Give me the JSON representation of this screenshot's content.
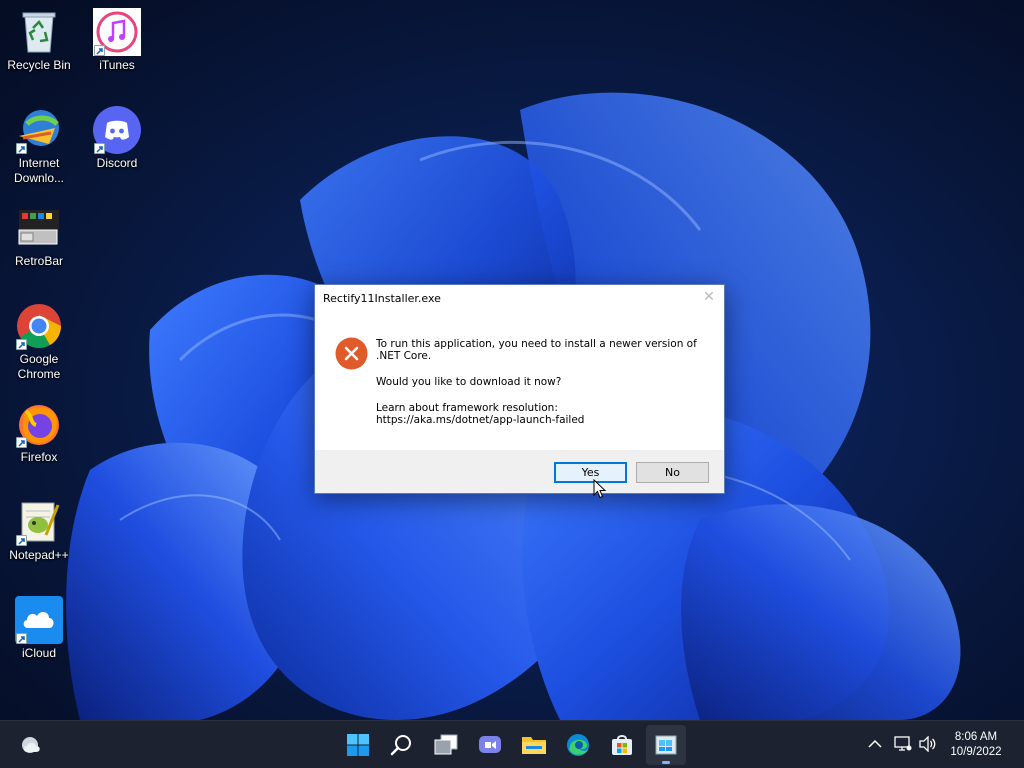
{
  "desktop": {
    "icons": [
      {
        "label": "Recycle Bin",
        "icon": "recycle-bin-icon"
      },
      {
        "label": "iTunes",
        "icon": "itunes-icon"
      },
      {
        "label": "Internet Downlo...",
        "icon": "internet-download-manager-icon"
      },
      {
        "label": "Discord",
        "icon": "discord-icon"
      },
      {
        "label": "RetroBar",
        "icon": "retrobar-icon"
      },
      {
        "label": "Google Chrome",
        "icon": "chrome-icon"
      },
      {
        "label": "Firefox",
        "icon": "firefox-icon"
      },
      {
        "label": "Notepad++",
        "icon": "notepadpp-icon"
      },
      {
        "label": "iCloud",
        "icon": "icloud-icon"
      }
    ]
  },
  "dialog": {
    "title": "Rectify11Installer.exe",
    "message": "To run this application, you need to install a newer version of .NET Core.",
    "question": "Would you like to download it now?",
    "learn_label": "Learn about framework resolution:",
    "learn_url": "https://aka.ms/dotnet/app-launch-failed",
    "yes_label": "Yes",
    "no_label": "No",
    "icon": "error-icon",
    "accent": "#e05a2a"
  },
  "taskbar": {
    "apps": [
      {
        "name": "start",
        "icon": "windows-start-icon"
      },
      {
        "name": "search",
        "icon": "search-icon"
      },
      {
        "name": "task-view",
        "icon": "task-view-icon"
      },
      {
        "name": "teams-chat",
        "icon": "chat-icon"
      },
      {
        "name": "file-explorer",
        "icon": "folder-icon"
      },
      {
        "name": "edge",
        "icon": "edge-icon"
      },
      {
        "name": "store",
        "icon": "store-icon"
      },
      {
        "name": "rectify11-installer",
        "icon": "installer-icon",
        "active": true
      }
    ],
    "clock": {
      "time": "8:06 AM",
      "date": "10/9/2022"
    }
  }
}
